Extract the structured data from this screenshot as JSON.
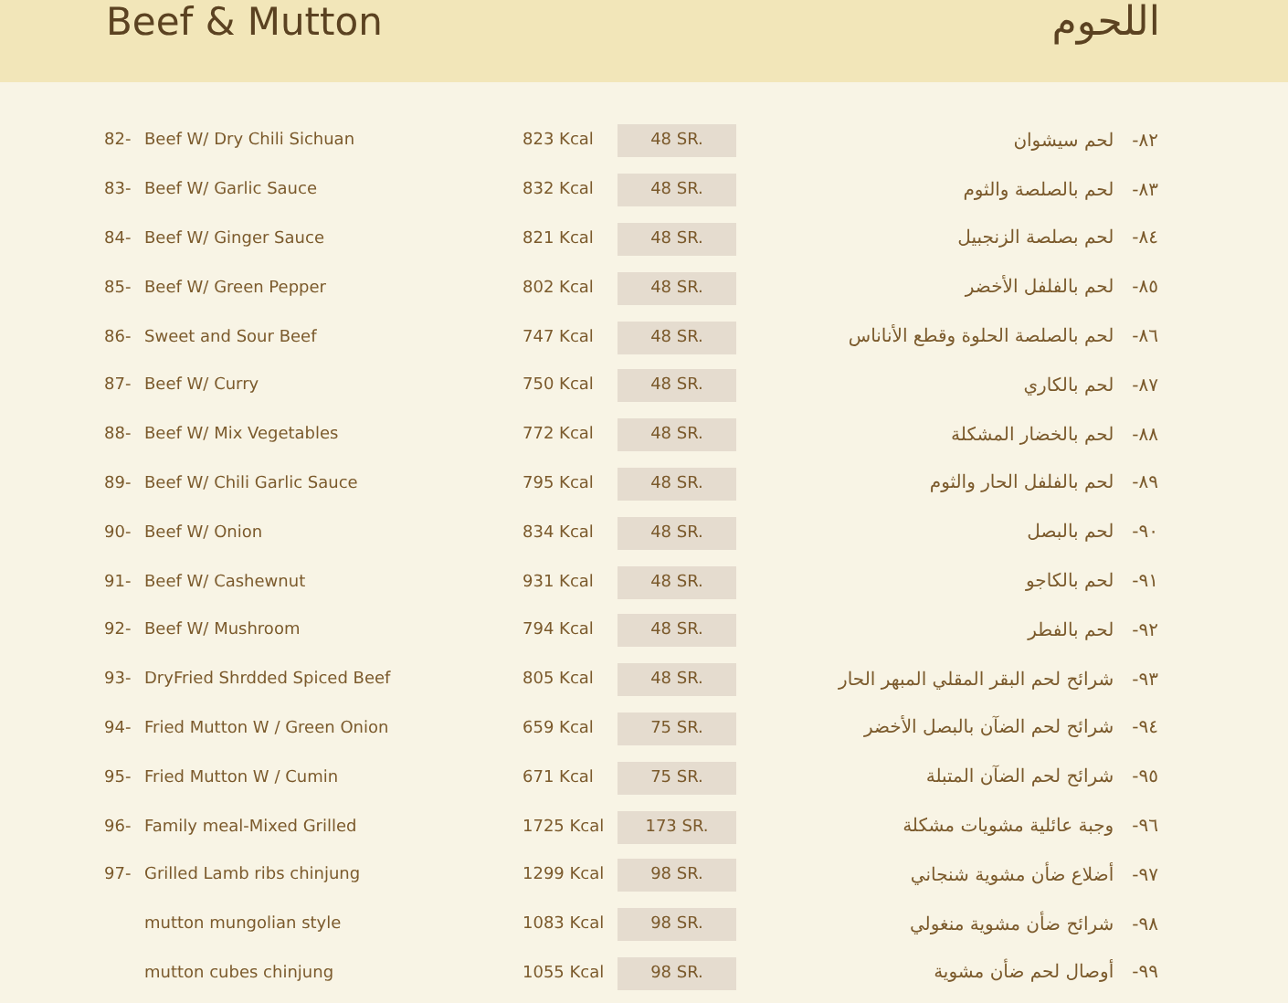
{
  "header": {
    "title_en": "Beef & Mutton",
    "title_ar": "اللحوم"
  },
  "items": [
    {
      "number": "82-",
      "name": "Beef W/ Dry Chili Sichuan",
      "calories": "823 Kcal",
      "price": "48 SR.",
      "number_ar": "-٨٢",
      "name_ar": "لحم سيشوان"
    },
    {
      "number": "83-",
      "name": "Beef W/ Garlic Sauce",
      "calories": "832 Kcal",
      "price": "48 SR.",
      "number_ar": "-٨٣",
      "name_ar": "لحم بالصلصة والثوم"
    },
    {
      "number": "84-",
      "name": "Beef W/ Ginger Sauce",
      "calories": "821 Kcal",
      "price": "48 SR.",
      "number_ar": "-٨٤",
      "name_ar": "لحم بصلصة الزنجبيل"
    },
    {
      "number": "85-",
      "name": "Beef W/ Green Pepper",
      "calories": "802 Kcal",
      "price": "48 SR.",
      "number_ar": "-٨٥",
      "name_ar": "لحم بالفلفل الأخضر"
    },
    {
      "number": "86-",
      "name": "Sweet and Sour Beef",
      "calories": "747 Kcal",
      "price": "48 SR.",
      "number_ar": "-٨٦",
      "name_ar": "لحم بالصلصة الحلوة وقطع الأناناس"
    },
    {
      "number": "87-",
      "name": "Beef W/ Curry",
      "calories": "750 Kcal",
      "price": "48 SR.",
      "number_ar": "-٨٧",
      "name_ar": "لحم بالكاري"
    },
    {
      "number": "88-",
      "name": "Beef W/ Mix Vegetables",
      "calories": "772 Kcal",
      "price": "48 SR.",
      "number_ar": "-٨٨",
      "name_ar": "لحم بالخضار المشكلة"
    },
    {
      "number": "89-",
      "name": "Beef W/ Chili Garlic Sauce",
      "calories": "795 Kcal",
      "price": "48 SR.",
      "number_ar": "-٨٩",
      "name_ar": "لحم بالفلفل الحار والثوم"
    },
    {
      "number": "90-",
      "name": "Beef W/ Onion",
      "calories": "834 Kcal",
      "price": "48 SR.",
      "number_ar": "-٩٠",
      "name_ar": "لحم بالبصل"
    },
    {
      "number": "91-",
      "name": "Beef W/ Cashewnut",
      "calories": "931 Kcal",
      "price": "48 SR.",
      "number_ar": "-٩١",
      "name_ar": "لحم بالكاجو"
    },
    {
      "number": "92-",
      "name": "Beef W/ Mushroom",
      "calories": "794 Kcal",
      "price": "48 SR.",
      "number_ar": "-٩٢",
      "name_ar": "لحم بالفطر"
    },
    {
      "number": "93-",
      "name": "DryFried Shrdded Spiced Beef",
      "calories": "805 Kcal",
      "price": "48 SR.",
      "number_ar": "-٩٣",
      "name_ar": "شرائح لحم البقر المقلي المبهر الحار"
    },
    {
      "number": "94-",
      "name": "Fried Mutton W / Green Onion",
      "calories": "659 Kcal",
      "price": "75 SR.",
      "number_ar": "-٩٤",
      "name_ar": "شرائح لحم الضآن بالبصل الأخضر"
    },
    {
      "number": "95-",
      "name": "Fried Mutton W / Cumin",
      "calories": "671 Kcal",
      "price": "75 SR.",
      "number_ar": "-٩٥",
      "name_ar": "شرائح لحم الضآن المتبلة"
    },
    {
      "number": "96-",
      "name": "Family meal-Mixed Grilled",
      "calories": "1725 Kcal",
      "price": "173 SR.",
      "number_ar": "-٩٦",
      "name_ar": "وجبة عائلية مشويات مشكلة"
    },
    {
      "number": "97-",
      "name": "Grilled Lamb ribs chinjung",
      "calories": "1299 Kcal",
      "price": "98 SR.",
      "number_ar": "-٩٧",
      "name_ar": "أضلاع ضأن مشوية شنجاني"
    },
    {
      "name": "mutton mungolian style",
      "calories": "1083 Kcal",
      "price": "98 SR.",
      "number_ar": "-٩٨",
      "name_ar": "شرائح ضأن مشوية منغولي"
    },
    {
      "name": "mutton cubes chinjung",
      "calories": "1055 Kcal",
      "price": "98 SR.",
      "number_ar": "-٩٩",
      "name_ar": "أوصال لحم ضأن مشوية"
    }
  ]
}
